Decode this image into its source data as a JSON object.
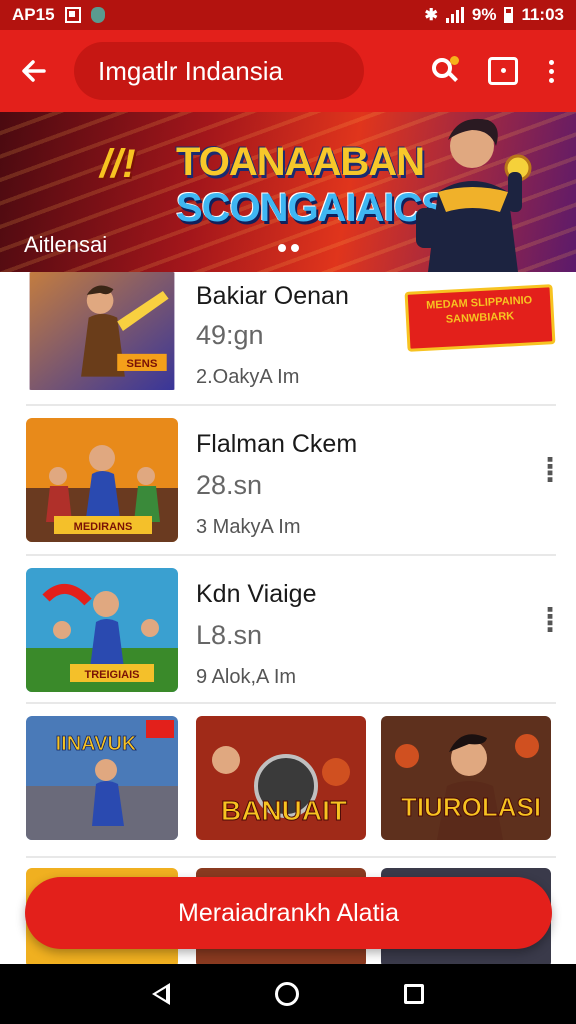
{
  "status_bar": {
    "time_left": "AP15",
    "battery_text": "9%",
    "time_right": "11:03"
  },
  "app_bar": {
    "title": "Imgatlr Indansia"
  },
  "banner": {
    "title_line1": "TOANAABAN",
    "title_line2": "SCONGAIAICS",
    "caption": "Aitlensai",
    "accent": "#e3201b"
  },
  "list": {
    "items": [
      {
        "title": "Bakiar Oenan",
        "size": "49:gn",
        "meta": "2.OakyA Im",
        "promo": "MEDAM SLIPPAINIO SANWBIARK"
      },
      {
        "title": "Flalman Ckem",
        "size": "28.sn",
        "meta": "3 MakyA Im",
        "thumb_text": "MEDIRANS"
      },
      {
        "title": "Kdn Viaige",
        "size": "L8.sn",
        "meta": "9 Alok,A Im",
        "thumb_text": "TREIGIAIS"
      }
    ]
  },
  "grid": {
    "tiles": [
      {
        "text": "IINAVUK"
      },
      {
        "text": "BANUAIT"
      },
      {
        "text": "TIUROLASI"
      }
    ]
  },
  "cta": {
    "label": "Meraiadrankh Alatia"
  },
  "colors": {
    "primary": "#e3201b",
    "status_bar": "#b3130f"
  }
}
